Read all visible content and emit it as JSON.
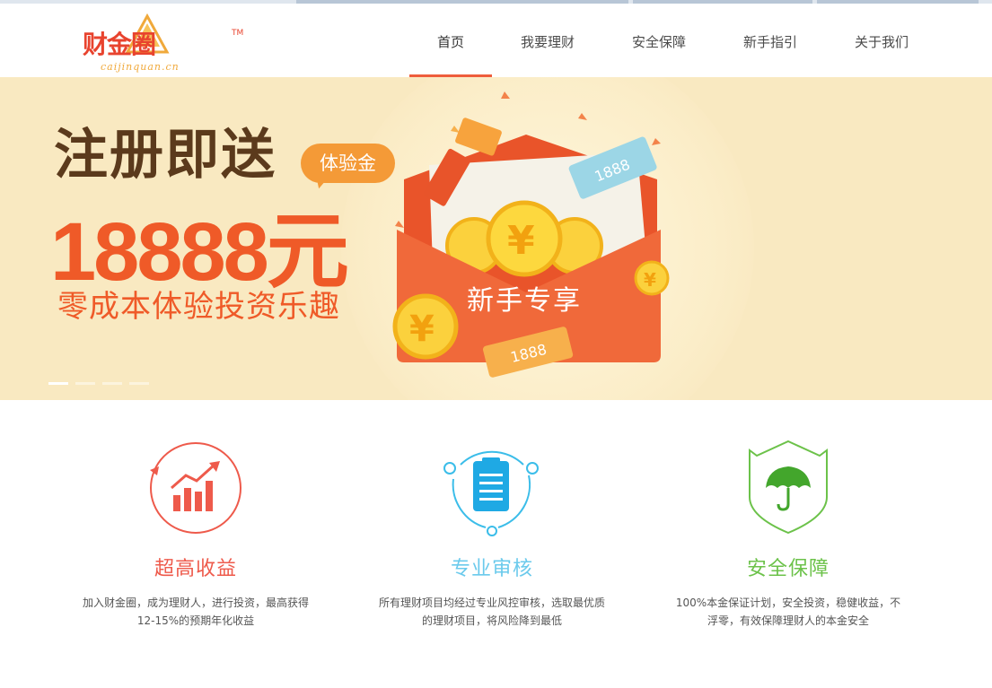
{
  "header": {
    "logo_text": "财金圈",
    "logo_sub": "caijinquan.cn",
    "logo_tm": "TM",
    "nav": [
      {
        "label": "首页",
        "active": true
      },
      {
        "label": "我要理财",
        "active": false
      },
      {
        "label": "安全保障",
        "active": false
      },
      {
        "label": "新手指引",
        "active": false
      },
      {
        "label": "关于我们",
        "active": false
      }
    ],
    "accent_color": "#ee5d3c"
  },
  "banner": {
    "headline_1": "注册即送",
    "badge": "体验金",
    "headline_2": "18888元",
    "headline_3": "零成本体验投资乐趣",
    "envelope_label": "新手专享",
    "ticket_text": "1888",
    "coin_symbol": "¥",
    "slides_total": 4,
    "slide_active": 1,
    "background": "#f9e9c1"
  },
  "features": [
    {
      "icon": "chart-up-icon",
      "title": "超高收益",
      "color": "#ee5a4b",
      "desc_line_1": "加入财金圈，成为理财人，进行投资，最高获得",
      "desc_line_2": "12-15%的预期年化收益"
    },
    {
      "icon": "clipboard-icon",
      "title": "专业审核",
      "color": "#3bbde9",
      "desc_line_1": "所有理财项目均经过专业风控审核，选取最优质",
      "desc_line_2": "的理财项目，将风险降到最低"
    },
    {
      "icon": "umbrella-shield-icon",
      "title": "安全保障",
      "color": "#6cc24a",
      "desc_line_1": "100%本金保证计划，安全投资，稳健收益，不",
      "desc_line_2": "浮零，有效保障理财人的本金安全"
    }
  ]
}
